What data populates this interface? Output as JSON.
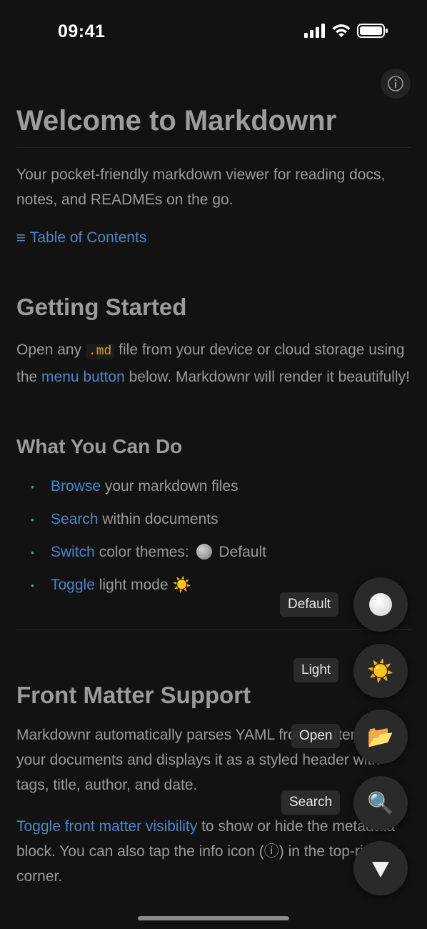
{
  "status_bar": {
    "time": "09:41"
  },
  "info_button": {
    "icon": "info-icon"
  },
  "doc": {
    "title": "Welcome to Markdownr",
    "intro": "Your pocket-friendly markdown viewer for reading docs, notes, and READMEs on the go.",
    "toc": {
      "icon": "≡",
      "label": "Table of Contents"
    },
    "getting_started": {
      "heading": "Getting Started",
      "text_before_code": "Open any ",
      "code": ".md",
      "text_after_code": " file from your device or cloud storage using the ",
      "link": "menu button",
      "text_after_link": " below. Markdownr will render it beautifully!"
    },
    "what_you_can_do": {
      "heading": "What You Can Do",
      "items": [
        {
          "link": "Browse",
          "text": " your markdown files"
        },
        {
          "link": "Search",
          "text": " within documents"
        },
        {
          "link": "Switch",
          "text": " color themes: ",
          "suffix": " Default"
        },
        {
          "link": "Toggle",
          "text": " light mode ",
          "suffix": "☀️"
        }
      ]
    },
    "front_matter": {
      "heading": "Front Matter Support",
      "para1": "Markdownr automatically parses YAML front matter from your documents and displays it as a styled header with tags, title, author, and date.",
      "para2_link": "Toggle front matter visibility",
      "para2_text": " to show or hide the metadata block. You can also tap the info icon (ⓘ) in the top-right corner."
    }
  },
  "fab_menu": {
    "items": [
      {
        "label": "Default",
        "icon": "circle-icon"
      },
      {
        "label": "Light",
        "icon": "sun-icon",
        "glyph": "☀️"
      },
      {
        "label": "Open",
        "icon": "folder-icon",
        "glyph": "📂"
      },
      {
        "label": "Search",
        "icon": "search-icon",
        "glyph": "🔍"
      }
    ],
    "toggle_icon": "collapse-icon"
  }
}
